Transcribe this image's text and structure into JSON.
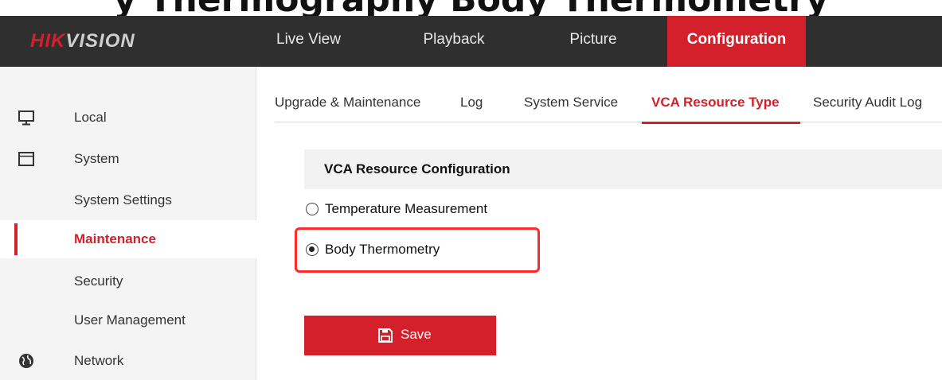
{
  "page_heading": "y Thermography Body Thermometry",
  "brand": {
    "logo_red": "HIK",
    "logo_rest": "VISION"
  },
  "nav": {
    "items": [
      {
        "label": "Live View"
      },
      {
        "label": "Playback"
      },
      {
        "label": "Picture"
      },
      {
        "label": "Configuration",
        "active": true
      }
    ]
  },
  "sidebar": {
    "items": [
      {
        "label": "Local",
        "icon": "monitor-icon"
      },
      {
        "label": "System",
        "icon": "window-icon"
      },
      {
        "label": "System Settings"
      },
      {
        "label": "Maintenance",
        "active": true
      },
      {
        "label": "Security"
      },
      {
        "label": "User Management"
      },
      {
        "label": "Network",
        "icon": "globe-icon"
      }
    ]
  },
  "tabs": [
    {
      "label": "Upgrade & Maintenance"
    },
    {
      "label": "Log"
    },
    {
      "label": "System Service"
    },
    {
      "label": "VCA Resource Type",
      "active": true
    },
    {
      "label": "Security Audit Log"
    }
  ],
  "section": {
    "title": "VCA Resource Configuration"
  },
  "options": [
    {
      "label": "Temperature Measurement",
      "checked": false
    },
    {
      "label": "Body Thermometry",
      "checked": true
    }
  ],
  "save_button": {
    "label": "Save"
  },
  "colors": {
    "accent": "#d4202a",
    "navbar": "#2f2f2f",
    "highlight": "#ff2b2b"
  }
}
